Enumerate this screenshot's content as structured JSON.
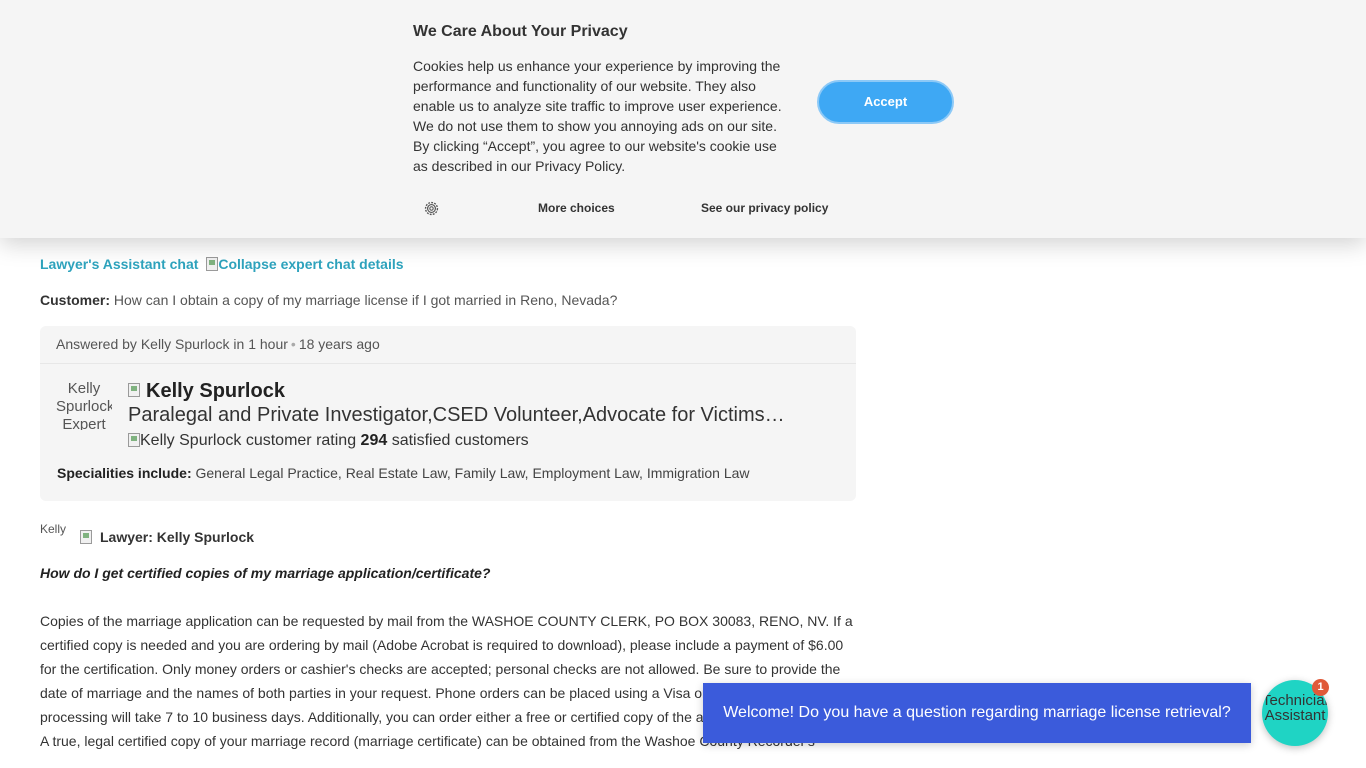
{
  "cookie_banner": {
    "title": "We Care About Your Privacy",
    "body": "Cookies help us enhance your experience by improving the performance and functionality of our website. They also enable us to analyze site traffic to improve user experience. We do not use them to show you annoying ads on our site. By clicking “Accept”, you agree to our website's cookie use as described in our Privacy Policy.",
    "accept_label": "Accept",
    "more_choices_label": "More choices",
    "privacy_policy_label": "See our privacy policy",
    "settings_icon": "gear-icon"
  },
  "chat_header": {
    "title": "Lawyer's Assistant chat",
    "collapse_alt": "Collapse expert chat details"
  },
  "customer": {
    "label": "Customer:",
    "question": "How can I obtain a copy of my marriage license if I got married in Reno, Nevada?"
  },
  "answer_card": {
    "answered_by": "Answered by Kelly Spurlock in 1 hour",
    "dot": "•",
    "ago": "18 years ago",
    "avatar_alt": "Kelly Spurlock Expert",
    "expert_name": "Kelly Spurlock",
    "expert_title": "Paralegal and Private Investigator,CSED Volunteer,Advocate for Victims of Domestic Violence",
    "rating_alt": "Kelly Spurlock customer rating",
    "satisfied_count": "294",
    "satisfied_label": "satisfied customers",
    "specialities_label": "Specialities include:",
    "specialities": "General Legal Practice, Real Estate Law, Family Law, Employment Law, Immigration Law"
  },
  "reply": {
    "avatar_alt": "Kelly",
    "author": "Lawyer: Kelly Spurlock",
    "heading": "How do I get certified copies of my marriage application/certificate?",
    "paragraph1": "Copies of the marriage application can be requested by mail from the WASHOE COUNTY CLERK, PO BOX 30083, RENO, NV. If a certified copy is needed and you are ordering by mail (Adobe Acrobat is required to download), please include a payment of $6.00 for the certification. Only money orders or cashier's checks are accepted; personal checks are not allowed. Be sure to provide the date of marriage and the names of both parties in your request. Phone orders can be placed using a Visa or Master card, and processing will take 7 to 10 business days. Additionally, you can order either a free or certified copy of the application online.",
    "paragraph2": "A true, legal certified copy of your marriage record (marriage certificate) can be obtained from the Washoe County Recorder's"
  },
  "chat_widget": {
    "welcome_message": "Welcome! Do you have a question regarding marriage license retrieval?",
    "assistant_label": "Technician's Assistant",
    "badge_count": "1"
  },
  "colors": {
    "accent_blue": "#3ea8f4",
    "link_teal": "#2ea3bd",
    "bubble_blue": "#3b5bdb",
    "fab_teal": "#1fd4c4",
    "badge_red": "#e05a3a"
  }
}
